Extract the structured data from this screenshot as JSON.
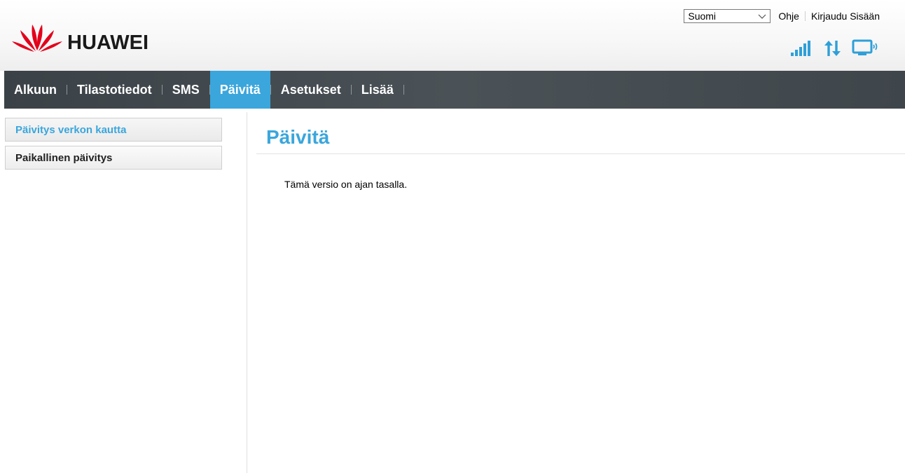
{
  "brand": {
    "name": "HUAWEI",
    "logo_icon": "huawei-flower-logo",
    "logo_color": "#e3001b"
  },
  "header": {
    "language": {
      "selected": "Suomi"
    },
    "help_label": "Ohje",
    "login_label": "Kirjaudu Sisään",
    "status_icons": [
      "signal-strength-icon",
      "data-transfer-icon",
      "wifi-device-icon"
    ]
  },
  "nav": {
    "items": [
      {
        "label": "Alkuun",
        "active": false
      },
      {
        "label": "Tilastotiedot",
        "active": false
      },
      {
        "label": "SMS",
        "active": false
      },
      {
        "label": "Päivitä",
        "active": true
      },
      {
        "label": "Asetukset",
        "active": false
      },
      {
        "label": "Lisää",
        "active": false
      }
    ]
  },
  "sidebar": {
    "items": [
      {
        "label": "Päivitys verkon kautta",
        "active": true
      },
      {
        "label": "Paikallinen päivitys",
        "active": false
      }
    ]
  },
  "main": {
    "title": "Päivitä",
    "status": "Tämä versio on ajan tasalla."
  },
  "colors": {
    "accent": "#3aa6dc",
    "nav_bg": "#444b50",
    "brand_red": "#e3001b"
  }
}
